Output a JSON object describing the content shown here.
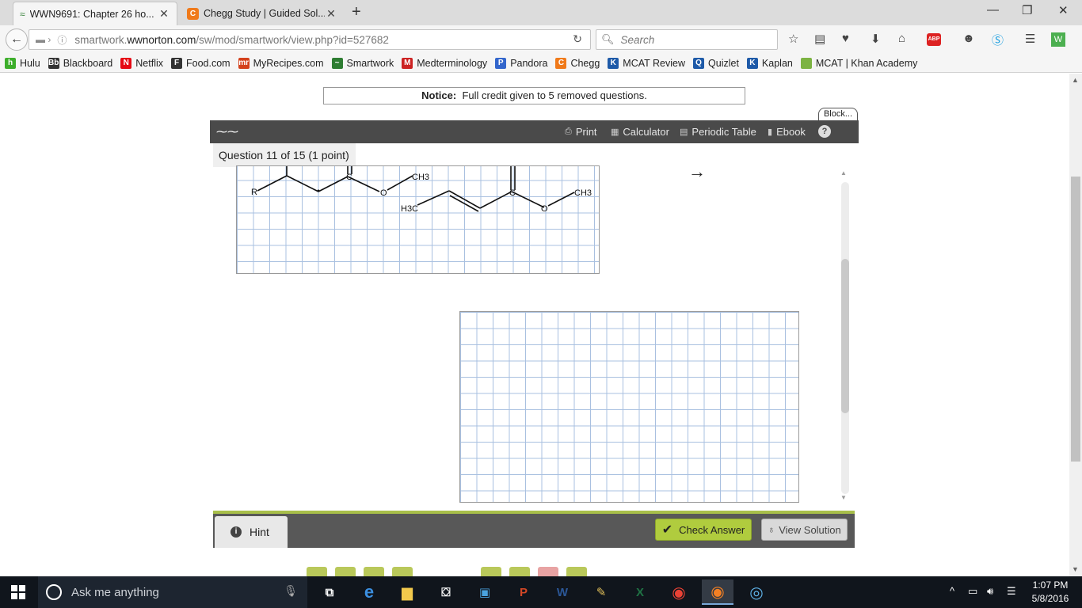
{
  "browser": {
    "tabs": [
      {
        "title": "WWN9691: Chapter 26 ho...",
        "icon": "smartwork-icon",
        "active": true
      },
      {
        "title": "Chegg Study | Guided Sol...",
        "icon": "chegg-icon",
        "active": false
      }
    ],
    "url_prefix": "smartwork.",
    "url_domain": "wwnorton.com",
    "url_path": "/sw/mod/smartwork/view.php?id=527682",
    "search_placeholder": "Search",
    "abp_label": "ABP"
  },
  "bookmarks": [
    {
      "label": "Hulu",
      "badge": "h",
      "color": "#3dae2b"
    },
    {
      "label": "Blackboard",
      "badge": "Bb",
      "color": "#333333"
    },
    {
      "label": "Netflix",
      "badge": "N",
      "color": "#e50914"
    },
    {
      "label": "Food.com",
      "badge": "F",
      "color": "#333333"
    },
    {
      "label": "MyRecipes.com",
      "badge": "mr",
      "color": "#d4411c"
    },
    {
      "label": "Smartwork",
      "badge": "~",
      "color": "#2e7d32"
    },
    {
      "label": "Medterminology",
      "badge": "M",
      "color": "#cc2222"
    },
    {
      "label": "Pandora",
      "badge": "P",
      "color": "#3366cc"
    },
    {
      "label": "Chegg",
      "badge": "C",
      "color": "#f07a1a"
    },
    {
      "label": "MCAT Review",
      "badge": "K",
      "color": "#1e5aa8"
    },
    {
      "label": "Quizlet",
      "badge": "Q",
      "color": "#1e5aa8"
    },
    {
      "label": "Kaplan",
      "badge": "K",
      "color": "#1e5aa8"
    },
    {
      "label": "MCAT | Khan Academy",
      "badge": "",
      "color": "#7cb342"
    }
  ],
  "notice": {
    "label": "Notice:",
    "text": "Full credit given to 5 removed questions."
  },
  "block_tab": "Block...",
  "toolbar": {
    "print": "Print",
    "calculator": "Calculator",
    "periodic_table": "Periodic Table",
    "ebook": "Ebook",
    "help": "?"
  },
  "question": {
    "header": "Question 11 of 15 (1 point)",
    "arrow": "→",
    "molecule_labels": {
      "r": "R",
      "c1": "C",
      "o1": "O",
      "ch3_top": "CH3",
      "h3c": "H3C",
      "c2": "C",
      "o2": "O",
      "ch3_right": "CH3"
    }
  },
  "buttons": {
    "hint": "Hint",
    "check_answer": "Check Answer",
    "view_solution": "View Solution"
  },
  "taskbar": {
    "search_placeholder": "Ask me anything",
    "time": "1:07 PM",
    "date": "5/8/2016"
  }
}
